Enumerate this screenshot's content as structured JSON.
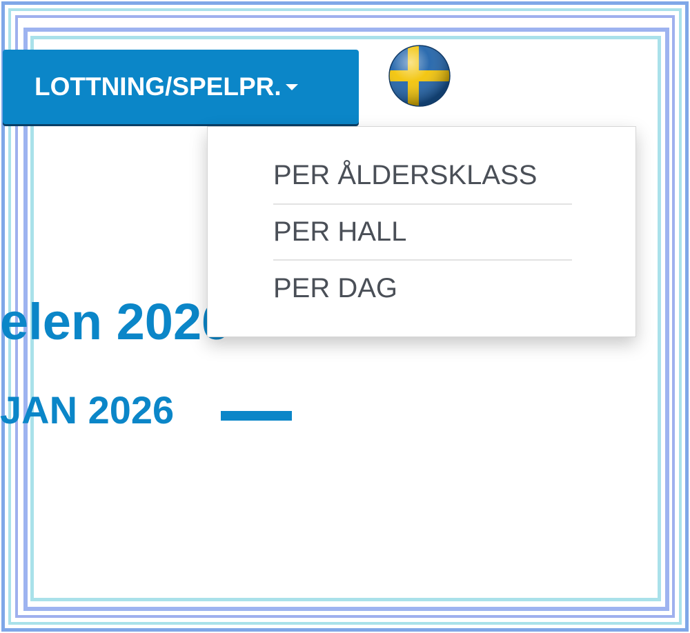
{
  "nav": {
    "dropdown_label": "LOTTNING/SPELPR.",
    "caret_icon": "caret-down-icon"
  },
  "language": {
    "flag_icon": "sweden-flag-icon",
    "flag_colors": {
      "blue": "#1a5fa8",
      "yellow": "#f2c200"
    }
  },
  "hero": {
    "title_fragment": "elen 2026",
    "date_fragment": "JAN 2026"
  },
  "dropdown_menu": {
    "items": [
      {
        "label": "PER ÅLDERSKLASS"
      },
      {
        "label": "PER HALL"
      },
      {
        "label": "PER DAG"
      }
    ]
  },
  "colors": {
    "accent": "#0b86c8",
    "menu_text": "#4a4f57"
  }
}
